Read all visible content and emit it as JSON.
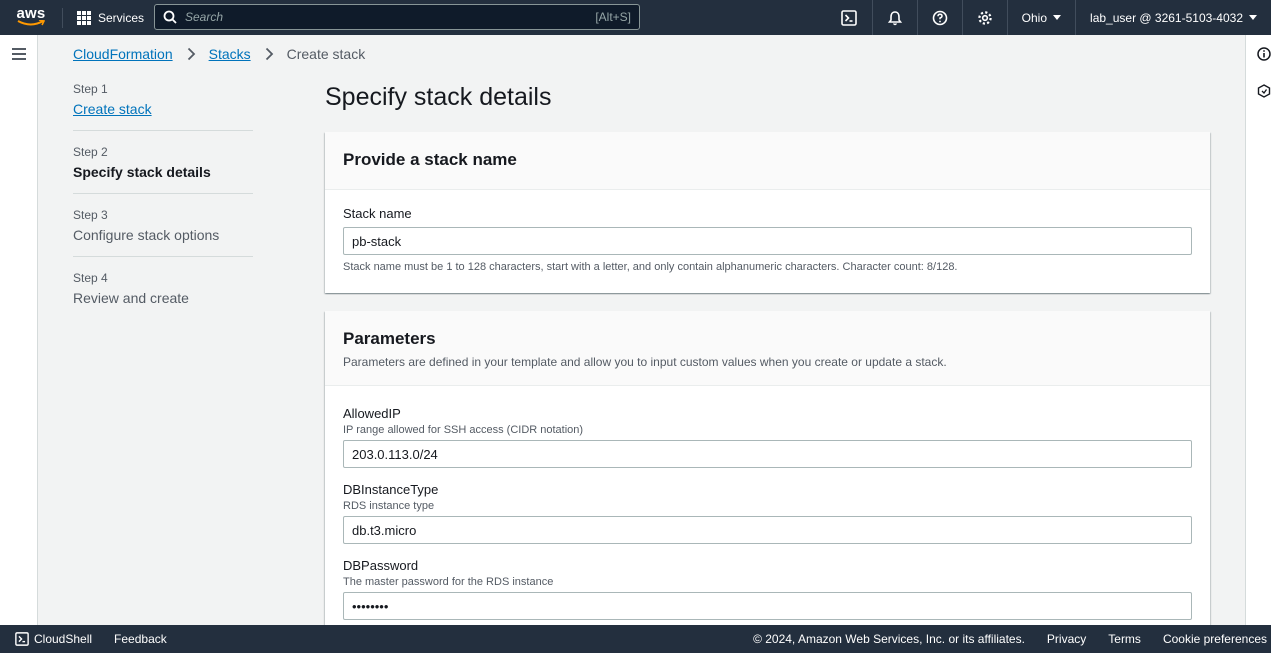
{
  "topnav": {
    "logo": "aws",
    "services_label": "Services",
    "search_placeholder": "Search",
    "search_shortcut": "[Alt+S]",
    "region": "Ohio",
    "account": "lab_user @ 3261-5103-4032"
  },
  "breadcrumb": {
    "items": [
      "CloudFormation",
      "Stacks",
      "Create stack"
    ]
  },
  "steps": [
    {
      "num": "Step 1",
      "label": "Create stack"
    },
    {
      "num": "Step 2",
      "label": "Specify stack details"
    },
    {
      "num": "Step 3",
      "label": "Configure stack options"
    },
    {
      "num": "Step 4",
      "label": "Review and create"
    }
  ],
  "page_title": "Specify stack details",
  "stack_name_panel": {
    "heading": "Provide a stack name",
    "label": "Stack name",
    "value": "pb-stack",
    "hint": "Stack name must be 1 to 128 characters, start with a letter, and only contain alphanumeric characters. Character count: 8/128."
  },
  "parameters_panel": {
    "heading": "Parameters",
    "description": "Parameters are defined in your template and allow you to input custom values when you create or update a stack.",
    "fields": [
      {
        "label": "AllowedIP",
        "desc": "IP range allowed for SSH access (CIDR notation)",
        "value": "203.0.113.0/24"
      },
      {
        "label": "DBInstanceType",
        "desc": "RDS instance type",
        "value": "db.t3.micro"
      },
      {
        "label": "DBPassword",
        "desc": "The master password for the RDS instance",
        "value": "••••••••"
      }
    ]
  },
  "footer": {
    "cloudshell": "CloudShell",
    "feedback": "Feedback",
    "copyright": "© 2024, Amazon Web Services, Inc. or its affiliates.",
    "privacy": "Privacy",
    "terms": "Terms",
    "cookies": "Cookie preferences"
  },
  "colors": {
    "nav_bg": "#232f3e",
    "link": "#0073bb",
    "page_bg": "#f2f3f3"
  }
}
